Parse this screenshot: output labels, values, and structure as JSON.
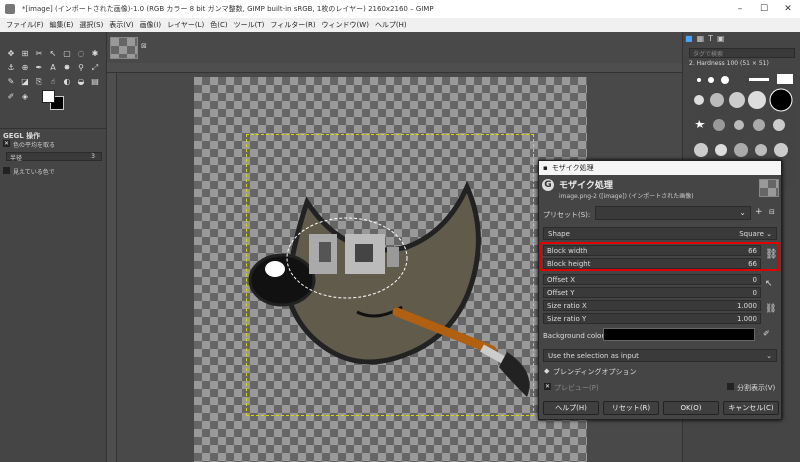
{
  "window": {
    "title": "*[image] (インポートされた画像)-1.0 (RGB カラー 8 bit ガンマ整数, GIMP built-in sRGB, 1枚のレイヤー) 2160x2160 – GIMP"
  },
  "menu": [
    "ファイル(F)",
    "編集(E)",
    "選択(S)",
    "表示(V)",
    "画像(I)",
    "レイヤー(L)",
    "色(C)",
    "ツール(T)",
    "フィルター(R)",
    "ウィンドウ(W)",
    "ヘルプ(H)"
  ],
  "tool_options": {
    "title": "GEGL 操作",
    "average_label": "色の平均を取る",
    "radius_label": "半径",
    "radius_value": "3",
    "visible_label": "見えている色で"
  },
  "brushes": {
    "search_placeholder": "タグで検索",
    "brush_name": "2. Hardness 100 (51 × 51)"
  },
  "dialog": {
    "title": "モザイク処理",
    "header": "モザイク処理",
    "subheader": "image.png-2 ([image]) (インポートされた画像)",
    "preset_label": "プリセット(S):",
    "shape_label": "Shape",
    "shape_value": "Square",
    "fields": [
      {
        "label": "Block width",
        "value": "66"
      },
      {
        "label": "Block height",
        "value": "66"
      },
      {
        "label": "Offset X",
        "value": "0"
      },
      {
        "label": "Offset Y",
        "value": "0"
      },
      {
        "label": "Size ratio X",
        "value": "1.000"
      },
      {
        "label": "Size ratio Y",
        "value": "1.000"
      }
    ],
    "bg_color_label": "Background color",
    "selection_input": "Use the selection as input",
    "blending_options": "ブレンディングオプション",
    "preview_label": "プレビュー(P)",
    "split_view_label": "分割表示(V)",
    "buttons": {
      "help": "ヘルプ(H)",
      "reset": "リセット(R)",
      "ok": "OK(O)",
      "cancel": "キャンセル(C)"
    }
  },
  "colors": {
    "highlight": "#e00000",
    "bg": "#454545"
  }
}
